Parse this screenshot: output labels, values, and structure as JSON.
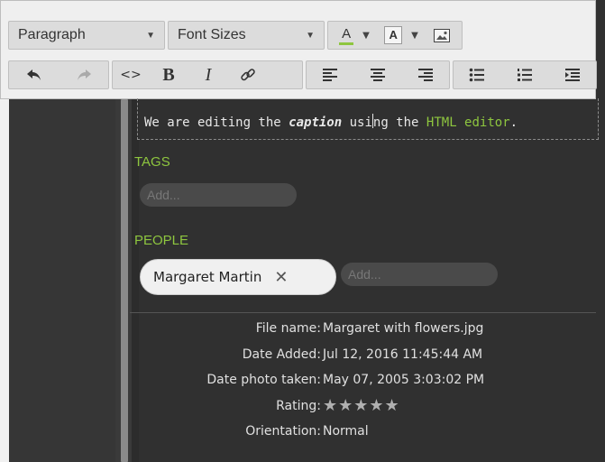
{
  "toolbar": {
    "paragraph_label": "Paragraph",
    "font_sizes_label": "Font Sizes",
    "font_color_letter": "A",
    "highlight_letter": "A",
    "font_color_underline": "#8ec63f"
  },
  "caption": {
    "before": "We are editing the ",
    "bold_word": "caption",
    "middle_a": " usi",
    "middle_b": "ng the ",
    "link_text": "HTML editor",
    "after": "."
  },
  "tags": {
    "label": "TAGS",
    "placeholder": "Add..."
  },
  "people": {
    "label": "PEOPLE",
    "person_name": "Margaret Martin",
    "remove_glyph": "✕",
    "placeholder": "Add..."
  },
  "metadata": [
    {
      "label": "File name:",
      "value": "Margaret with flowers.jpg"
    },
    {
      "label": "Date Added:",
      "value": "Jul 12, 2016 11:45:44 AM"
    },
    {
      "label": "Date photo taken:",
      "value": "May 07, 2005 3:03:02 PM"
    },
    {
      "label": "Rating:",
      "value": "★★★★★"
    },
    {
      "label": "Orientation:",
      "value": "Normal"
    }
  ],
  "rating_stars": 0,
  "colors": {
    "accent": "#8ec63f",
    "panel_bg": "#303030"
  }
}
